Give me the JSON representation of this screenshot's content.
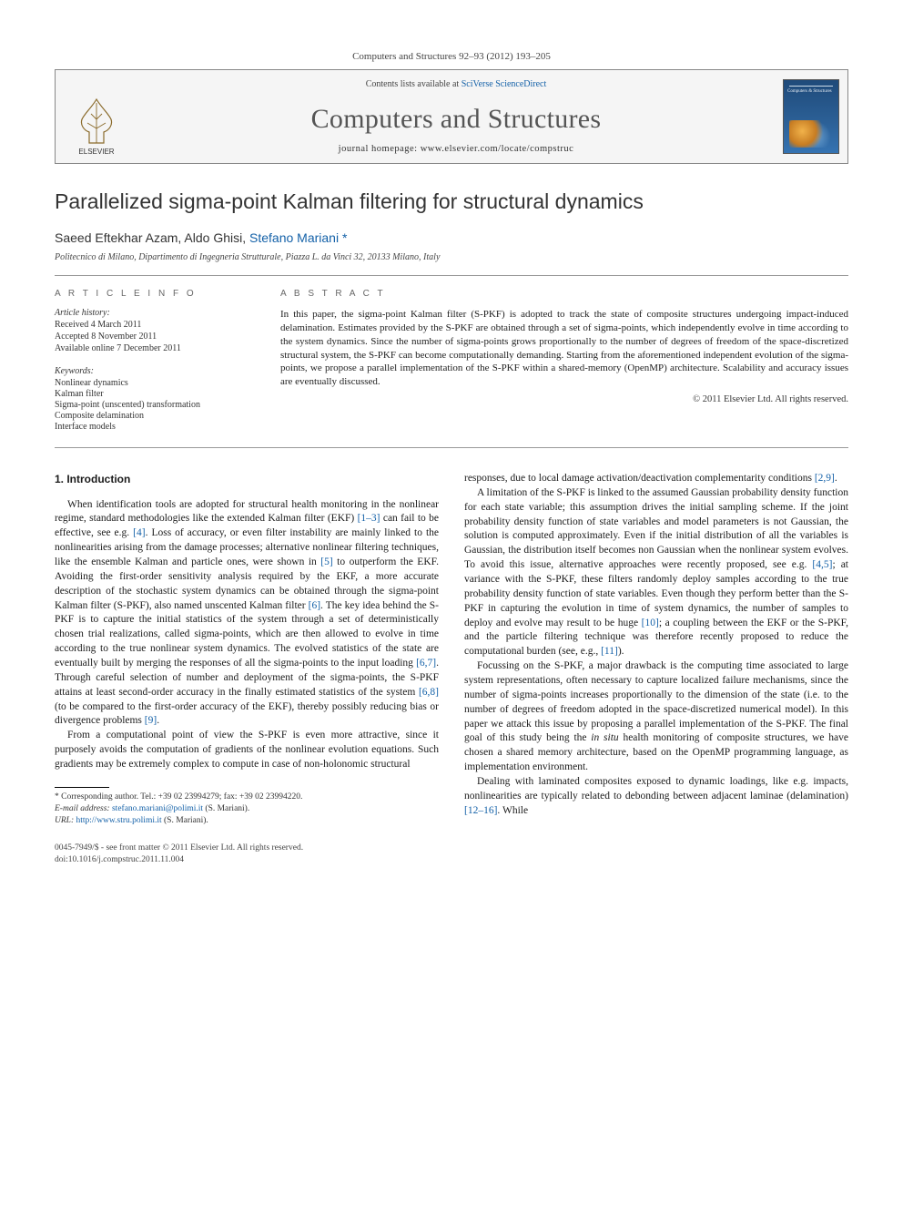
{
  "citation": "Computers and Structures 92–93 (2012) 193–205",
  "header": {
    "contents_prefix": "Contents lists available at ",
    "contents_link": "SciVerse ScienceDirect",
    "journal": "Computers and Structures",
    "homepage_prefix": "journal homepage: ",
    "homepage": "www.elsevier.com/locate/compstruc",
    "publisher": "ELSEVIER",
    "cover_title": "Computers & Structures"
  },
  "title": "Parallelized sigma-point Kalman filtering for structural dynamics",
  "authors": {
    "list": "Saeed Eftekhar Azam, Aldo Ghisi, ",
    "corresponding": "Stefano Mariani",
    "marker": "*"
  },
  "affiliation": "Politecnico di Milano, Dipartimento di Ingegneria Strutturale, Piazza L. da Vinci 32, 20133 Milano, Italy",
  "article_info": {
    "heading": "A R T I C L E   I N F O",
    "history_label": "Article history:",
    "received": "Received 4 March 2011",
    "accepted": "Accepted 8 November 2011",
    "online": "Available online 7 December 2011",
    "keywords_label": "Keywords:",
    "keywords": [
      "Nonlinear dynamics",
      "Kalman filter",
      "Sigma-point (unscented) transformation",
      "Composite delamination",
      "Interface models"
    ]
  },
  "abstract": {
    "heading": "A B S T R A C T",
    "text": "In this paper, the sigma-point Kalman filter (S-PKF) is adopted to track the state of composite structures undergoing impact-induced delamination. Estimates provided by the S-PKF are obtained through a set of sigma-points, which independently evolve in time according to the system dynamics. Since the number of sigma-points grows proportionally to the number of degrees of freedom of the space-discretized structural system, the S-PKF can become computationally demanding. Starting from the aforementioned independent evolution of the sigma-points, we propose a parallel implementation of the S-PKF within a shared-memory (OpenMP) architecture. Scalability and accuracy issues are eventually discussed.",
    "copyright": "© 2011 Elsevier Ltd. All rights reserved."
  },
  "section1": {
    "heading": "1. Introduction",
    "p1a": "When identification tools are adopted for structural health monitoring in the nonlinear regime, standard methodologies like the extended Kalman filter (EKF) ",
    "p1_ref1": "[1–3]",
    "p1b": " can fail to be effective, see e.g. ",
    "p1_ref2": "[4]",
    "p1c": ". Loss of accuracy, or even filter instability are mainly linked to the nonlinearities arising from the damage processes; alternative nonlinear filtering techniques, like the ensemble Kalman and particle ones, were shown in ",
    "p1_ref3": "[5]",
    "p1d": " to outperform the EKF. Avoiding the first-order sensitivity analysis required by the EKF, a more accurate description of the stochastic system dynamics can be obtained through the sigma-point Kalman filter (S-PKF), also named unscented Kalman filter ",
    "p1_ref4": "[6]",
    "p1e": ". The key idea behind the S-PKF is to capture the initial statistics of the system through a set of deterministically chosen trial realizations, called sigma-points, which are then allowed to evolve in time according to the true nonlinear system dynamics. The evolved statistics of the state are eventually built by merging the responses of all the sigma-points to the input loading ",
    "p1_ref5": "[6,7]",
    "p1f": ". Through careful selection of number and deployment of the sigma-points, the S-PKF attains at least second-order accuracy in the finally estimated statistics of the system ",
    "p1_ref6": "[6,8]",
    "p1g": " (to be compared to the first-order accuracy of the EKF), thereby possibly reducing bias or divergence problems ",
    "p1_ref7": "[9]",
    "p1h": ".",
    "p2": "From a computational point of view the S-PKF is even more attractive, since it purposely avoids the computation of gradients of the nonlinear evolution equations. Such gradients may be extremely complex to compute in case of non-holonomic structural",
    "p3a": "responses, due to local damage activation/deactivation complementarity conditions ",
    "p3_ref1": "[2,9]",
    "p3b": ".",
    "p4a": "A limitation of the S-PKF is linked to the assumed Gaussian probability density function for each state variable; this assumption drives the initial sampling scheme. If the joint probability density function of state variables and model parameters is not Gaussian, the solution is computed approximately. Even if the initial distribution of all the variables is Gaussian, the distribution itself becomes non Gaussian when the nonlinear system evolves. To avoid this issue, alternative approaches were recently proposed, see e.g. ",
    "p4_ref1": "[4,5]",
    "p4b": "; at variance with the S-PKF, these filters randomly deploy samples according to the true probability density function of state variables. Even though they perform better than the S-PKF in capturing the evolution in time of system dynamics, the number of samples to deploy and evolve may result to be huge ",
    "p4_ref2": "[10]",
    "p4c": "; a coupling between the EKF or the S-PKF, and the particle filtering technique was therefore recently proposed to reduce the computational burden (see, e.g., ",
    "p4_ref3": "[11]",
    "p4d": ").",
    "p5a": "Focussing on the S-PKF, a major drawback is the computing time associated to large system representations, often necessary to capture localized failure mechanisms, since the number of sigma-points increases proportionally to the dimension of the state (i.e. to the number of degrees of freedom adopted in the space-discretized numerical model). In this paper we attack this issue by proposing a parallel implementation of the S-PKF. The final goal of this study being the ",
    "p5_ital": "in situ",
    "p5b": " health monitoring of composite structures, we have chosen a shared memory architecture, based on the OpenMP programming language, as implementation environment.",
    "p6a": "Dealing with laminated composites exposed to dynamic loadings, like e.g. impacts, nonlinearities are typically related to debonding between adjacent laminae (delamination) ",
    "p6_ref1": "[12–16]",
    "p6b": ". While"
  },
  "corresponding": {
    "label": "* Corresponding author. Tel.: +39 02 23994279; fax: +39 02 23994220.",
    "email_label": "E-mail address: ",
    "email": "stefano.mariani@polimi.it",
    "email_who": " (S. Mariani).",
    "url_label": "URL: ",
    "url": "http://www.stru.polimi.it",
    "url_who": " (S. Mariani)."
  },
  "footer": {
    "line1": "0045-7949/$ - see front matter © 2011 Elsevier Ltd. All rights reserved.",
    "line2": "doi:10.1016/j.compstruc.2011.11.004"
  }
}
